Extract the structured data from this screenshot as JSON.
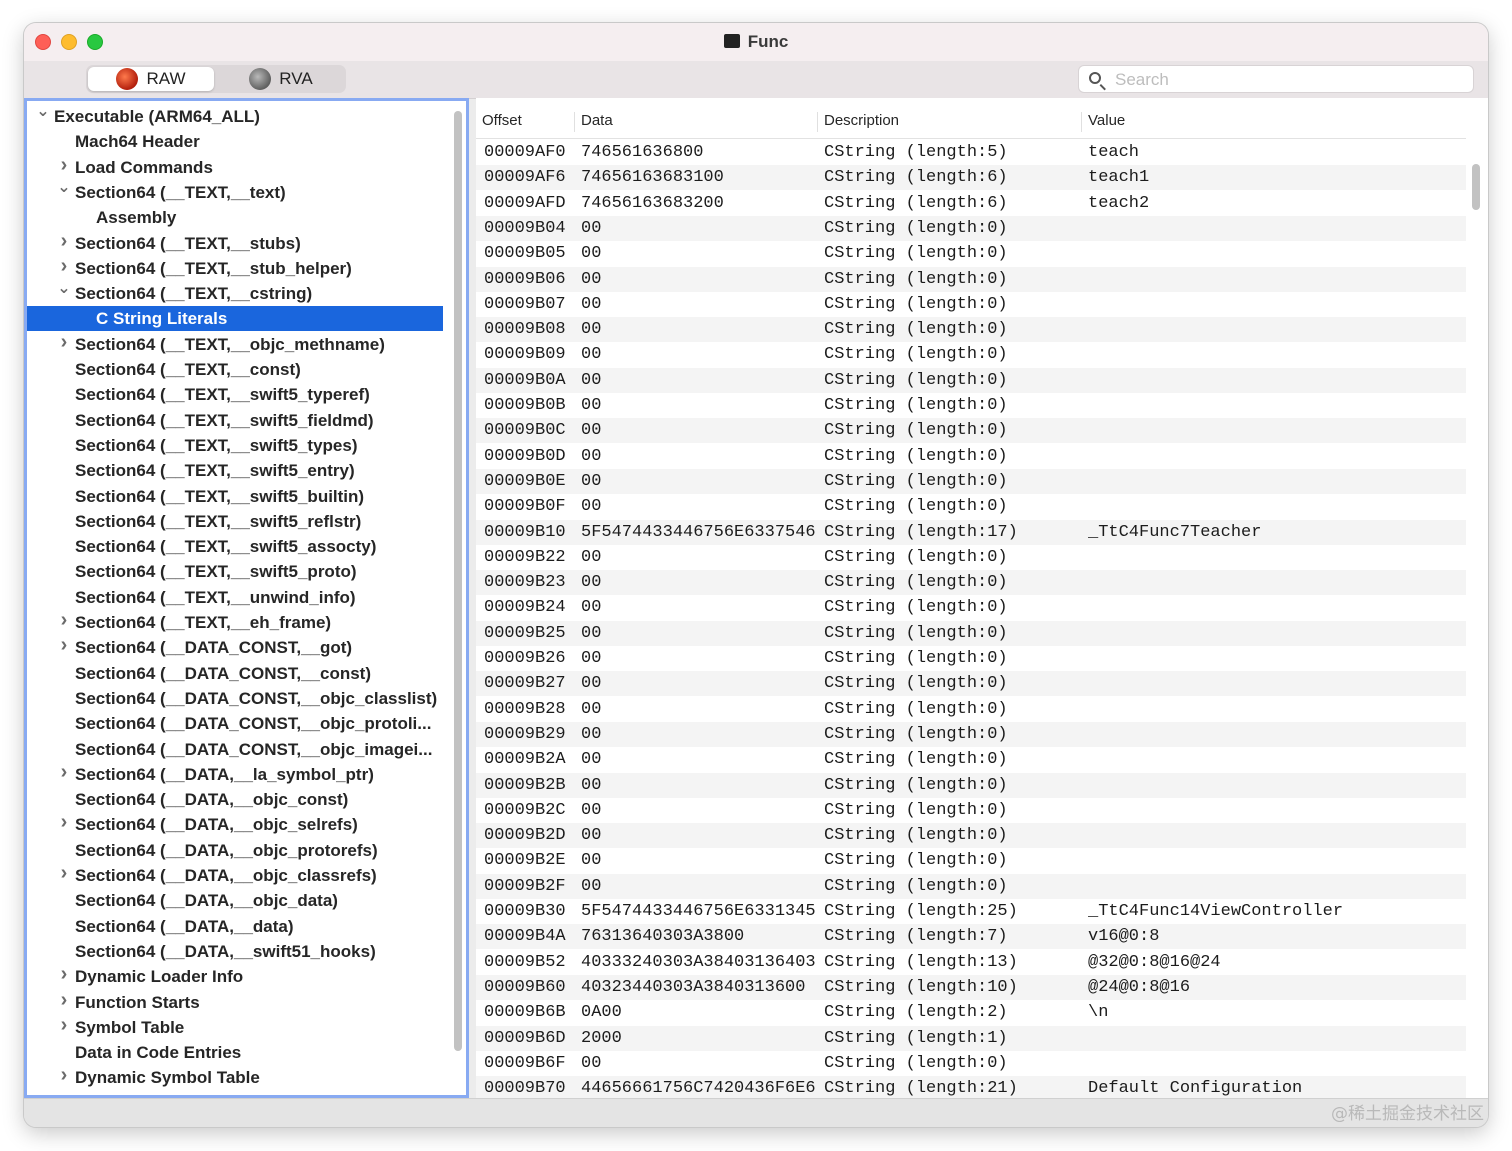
{
  "window": {
    "title": "Func"
  },
  "toolbar": {
    "raw_label": "RAW",
    "rva_label": "RVA",
    "search_placeholder": "Search"
  },
  "sidebar": {
    "items": [
      {
        "label": "Executable  (ARM64_ALL)",
        "level": 0,
        "disclosure": "open",
        "selected": false
      },
      {
        "label": "Mach64 Header",
        "level": 1,
        "disclosure": "none",
        "selected": false
      },
      {
        "label": "Load Commands",
        "level": 1,
        "disclosure": "closed",
        "selected": false
      },
      {
        "label": "Section64 (__TEXT,__text)",
        "level": 1,
        "disclosure": "open",
        "selected": false
      },
      {
        "label": "Assembly",
        "level": 2,
        "disclosure": "none",
        "selected": false
      },
      {
        "label": "Section64 (__TEXT,__stubs)",
        "level": 1,
        "disclosure": "closed",
        "selected": false
      },
      {
        "label": "Section64 (__TEXT,__stub_helper)",
        "level": 1,
        "disclosure": "closed",
        "selected": false
      },
      {
        "label": "Section64 (__TEXT,__cstring)",
        "level": 1,
        "disclosure": "open",
        "selected": false
      },
      {
        "label": "C String Literals",
        "level": 2,
        "disclosure": "none",
        "selected": true
      },
      {
        "label": "Section64 (__TEXT,__objc_methname)",
        "level": 1,
        "disclosure": "closed",
        "selected": false
      },
      {
        "label": "Section64 (__TEXT,__const)",
        "level": 1,
        "disclosure": "none",
        "selected": false
      },
      {
        "label": "Section64 (__TEXT,__swift5_typeref)",
        "level": 1,
        "disclosure": "none",
        "selected": false
      },
      {
        "label": "Section64 (__TEXT,__swift5_fieldmd)",
        "level": 1,
        "disclosure": "none",
        "selected": false
      },
      {
        "label": "Section64 (__TEXT,__swift5_types)",
        "level": 1,
        "disclosure": "none",
        "selected": false
      },
      {
        "label": "Section64 (__TEXT,__swift5_entry)",
        "level": 1,
        "disclosure": "none",
        "selected": false
      },
      {
        "label": "Section64 (__TEXT,__swift5_builtin)",
        "level": 1,
        "disclosure": "none",
        "selected": false
      },
      {
        "label": "Section64 (__TEXT,__swift5_reflstr)",
        "level": 1,
        "disclosure": "none",
        "selected": false
      },
      {
        "label": "Section64 (__TEXT,__swift5_assocty)",
        "level": 1,
        "disclosure": "none",
        "selected": false
      },
      {
        "label": "Section64 (__TEXT,__swift5_proto)",
        "level": 1,
        "disclosure": "none",
        "selected": false
      },
      {
        "label": "Section64 (__TEXT,__unwind_info)",
        "level": 1,
        "disclosure": "none",
        "selected": false
      },
      {
        "label": "Section64 (__TEXT,__eh_frame)",
        "level": 1,
        "disclosure": "closed",
        "selected": false
      },
      {
        "label": "Section64 (__DATA_CONST,__got)",
        "level": 1,
        "disclosure": "closed",
        "selected": false
      },
      {
        "label": "Section64 (__DATA_CONST,__const)",
        "level": 1,
        "disclosure": "none",
        "selected": false
      },
      {
        "label": "Section64 (__DATA_CONST,__objc_classlist)",
        "level": 1,
        "disclosure": "none",
        "selected": false
      },
      {
        "label": "Section64 (__DATA_CONST,__objc_protoli...",
        "level": 1,
        "disclosure": "none",
        "selected": false
      },
      {
        "label": "Section64 (__DATA_CONST,__objc_imagei...",
        "level": 1,
        "disclosure": "none",
        "selected": false
      },
      {
        "label": "Section64 (__DATA,__la_symbol_ptr)",
        "level": 1,
        "disclosure": "closed",
        "selected": false
      },
      {
        "label": "Section64 (__DATA,__objc_const)",
        "level": 1,
        "disclosure": "none",
        "selected": false
      },
      {
        "label": "Section64 (__DATA,__objc_selrefs)",
        "level": 1,
        "disclosure": "closed",
        "selected": false
      },
      {
        "label": "Section64 (__DATA,__objc_protorefs)",
        "level": 1,
        "disclosure": "none",
        "selected": false
      },
      {
        "label": "Section64 (__DATA,__objc_classrefs)",
        "level": 1,
        "disclosure": "closed",
        "selected": false
      },
      {
        "label": "Section64 (__DATA,__objc_data)",
        "level": 1,
        "disclosure": "none",
        "selected": false
      },
      {
        "label": "Section64 (__DATA,__data)",
        "level": 1,
        "disclosure": "none",
        "selected": false
      },
      {
        "label": "Section64 (__DATA,__swift51_hooks)",
        "level": 1,
        "disclosure": "none",
        "selected": false
      },
      {
        "label": "Dynamic Loader Info",
        "level": 1,
        "disclosure": "closed",
        "selected": false
      },
      {
        "label": "Function Starts",
        "level": 1,
        "disclosure": "closed",
        "selected": false
      },
      {
        "label": "Symbol Table",
        "level": 1,
        "disclosure": "closed",
        "selected": false
      },
      {
        "label": "Data in Code Entries",
        "level": 1,
        "disclosure": "none",
        "selected": false
      },
      {
        "label": "Dynamic Symbol Table",
        "level": 1,
        "disclosure": "closed",
        "selected": false
      }
    ]
  },
  "table": {
    "columns": [
      "Offset",
      "Data",
      "Description",
      "Value"
    ],
    "rows": [
      [
        "00009AF0",
        "746561636800",
        "CString (length:5)",
        "teach"
      ],
      [
        "00009AF6",
        "74656163683100",
        "CString (length:6)",
        "teach1"
      ],
      [
        "00009AFD",
        "74656163683200",
        "CString (length:6)",
        "teach2"
      ],
      [
        "00009B04",
        "00",
        "CString (length:0)",
        ""
      ],
      [
        "00009B05",
        "00",
        "CString (length:0)",
        ""
      ],
      [
        "00009B06",
        "00",
        "CString (length:0)",
        ""
      ],
      [
        "00009B07",
        "00",
        "CString (length:0)",
        ""
      ],
      [
        "00009B08",
        "00",
        "CString (length:0)",
        ""
      ],
      [
        "00009B09",
        "00",
        "CString (length:0)",
        ""
      ],
      [
        "00009B0A",
        "00",
        "CString (length:0)",
        ""
      ],
      [
        "00009B0B",
        "00",
        "CString (length:0)",
        ""
      ],
      [
        "00009B0C",
        "00",
        "CString (length:0)",
        ""
      ],
      [
        "00009B0D",
        "00",
        "CString (length:0)",
        ""
      ],
      [
        "00009B0E",
        "00",
        "CString (length:0)",
        ""
      ],
      [
        "00009B0F",
        "00",
        "CString (length:0)",
        ""
      ],
      [
        "00009B10",
        "5F5474433446756E6337546...",
        "CString (length:17)",
        "_TtC4Func7Teacher"
      ],
      [
        "00009B22",
        "00",
        "CString (length:0)",
        ""
      ],
      [
        "00009B23",
        "00",
        "CString (length:0)",
        ""
      ],
      [
        "00009B24",
        "00",
        "CString (length:0)",
        ""
      ],
      [
        "00009B25",
        "00",
        "CString (length:0)",
        ""
      ],
      [
        "00009B26",
        "00",
        "CString (length:0)",
        ""
      ],
      [
        "00009B27",
        "00",
        "CString (length:0)",
        ""
      ],
      [
        "00009B28",
        "00",
        "CString (length:0)",
        ""
      ],
      [
        "00009B29",
        "00",
        "CString (length:0)",
        ""
      ],
      [
        "00009B2A",
        "00",
        "CString (length:0)",
        ""
      ],
      [
        "00009B2B",
        "00",
        "CString (length:0)",
        ""
      ],
      [
        "00009B2C",
        "00",
        "CString (length:0)",
        ""
      ],
      [
        "00009B2D",
        "00",
        "CString (length:0)",
        ""
      ],
      [
        "00009B2E",
        "00",
        "CString (length:0)",
        ""
      ],
      [
        "00009B2F",
        "00",
        "CString (length:0)",
        ""
      ],
      [
        "00009B30",
        "5F5474433446756E6331345...",
        "CString (length:25)",
        "_TtC4Func14ViewController"
      ],
      [
        "00009B4A",
        "76313640303A3800",
        "CString (length:7)",
        "v16@0:8"
      ],
      [
        "00009B52",
        "40333240303A38403136403...",
        "CString (length:13)",
        "@32@0:8@16@24"
      ],
      [
        "00009B60",
        "40323440303A3840313600",
        "CString (length:10)",
        "@24@0:8@16"
      ],
      [
        "00009B6B",
        "0A00",
        "CString (length:2)",
        "\\n"
      ],
      [
        "00009B6D",
        "2000",
        "CString (length:1)",
        ""
      ],
      [
        "00009B6F",
        "00",
        "CString (length:0)",
        ""
      ],
      [
        "00009B70",
        "44656661756C7420436F6E6...",
        "CString (length:21)",
        "Default Configuration"
      ]
    ]
  },
  "watermark": "@稀土掘金技术社区"
}
